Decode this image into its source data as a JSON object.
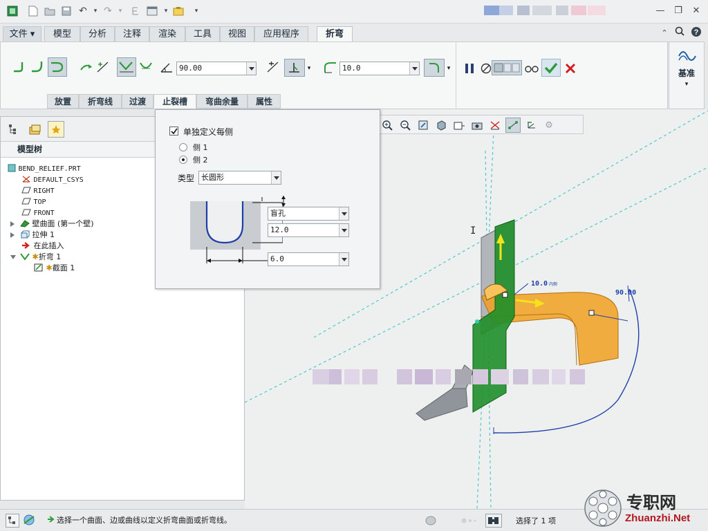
{
  "menu_tabs": [
    {
      "label": "文件 ▾"
    },
    {
      "label": "模型"
    },
    {
      "label": "分析"
    },
    {
      "label": "注释"
    },
    {
      "label": "渲染"
    },
    {
      "label": "工具"
    },
    {
      "label": "视图"
    },
    {
      "label": "应用程序"
    },
    {
      "label": "折弯"
    }
  ],
  "ribbon": {
    "angle_value": "90.00",
    "radius_value": "10.0",
    "subtabs": [
      {
        "label": "放置"
      },
      {
        "label": "折弯线"
      },
      {
        "label": "过渡"
      },
      {
        "label": "止裂槽"
      },
      {
        "label": "弯曲余量"
      },
      {
        "label": "属性"
      }
    ],
    "datum_label": "基准"
  },
  "relief_panel": {
    "checkbox_label": "单独定义每侧",
    "checkbox_checked": true,
    "side1_label": "侧 1",
    "side2_label": "侧 2",
    "selected_side": "侧 2",
    "type_label": "类型",
    "type_value": "长圆形",
    "depth_value": "盲孔",
    "depth_dim": "12.0",
    "width_dim": "6.0"
  },
  "model_tree": {
    "title": "模型树",
    "items": [
      {
        "label": "BEND_RELIEF.PRT"
      },
      {
        "label": "DEFAULT_CSYS"
      },
      {
        "label": "RIGHT"
      },
      {
        "label": "TOP"
      },
      {
        "label": "FRONT"
      },
      {
        "label": "壁曲面 (第一个壁)"
      },
      {
        "label": "拉伸 1"
      },
      {
        "label": "在此插入"
      },
      {
        "label": "折弯 1"
      },
      {
        "label": "截面 1"
      }
    ]
  },
  "graphics": {
    "dim_radius_label": "10.0",
    "dim_radius_suffix": "内侧",
    "dim_angle_label": "90.00"
  },
  "status": {
    "message": "选择一个曲面、边或曲线以定义折弯曲面或折弯线。",
    "selection_count": "选择了 1 项",
    "watermark_cn": "专职网",
    "watermark_en": "Zhuanzhi.Net"
  },
  "colors": {
    "accent_green": "#2e9b3a",
    "cancel_red": "#d11e1e",
    "model_orange": "#f0a020",
    "model_green": "#1f8f2a",
    "datum_cyan": "#4dc8c8"
  },
  "icons": [
    "bend-icon",
    "flip-icon",
    "angle-icon",
    "radius-icon",
    "pause-icon",
    "preview-icon",
    "glasses-icon",
    "check-icon",
    "cancel-icon",
    "zoom-in-icon",
    "zoom-out-icon",
    "datum-icon"
  ]
}
